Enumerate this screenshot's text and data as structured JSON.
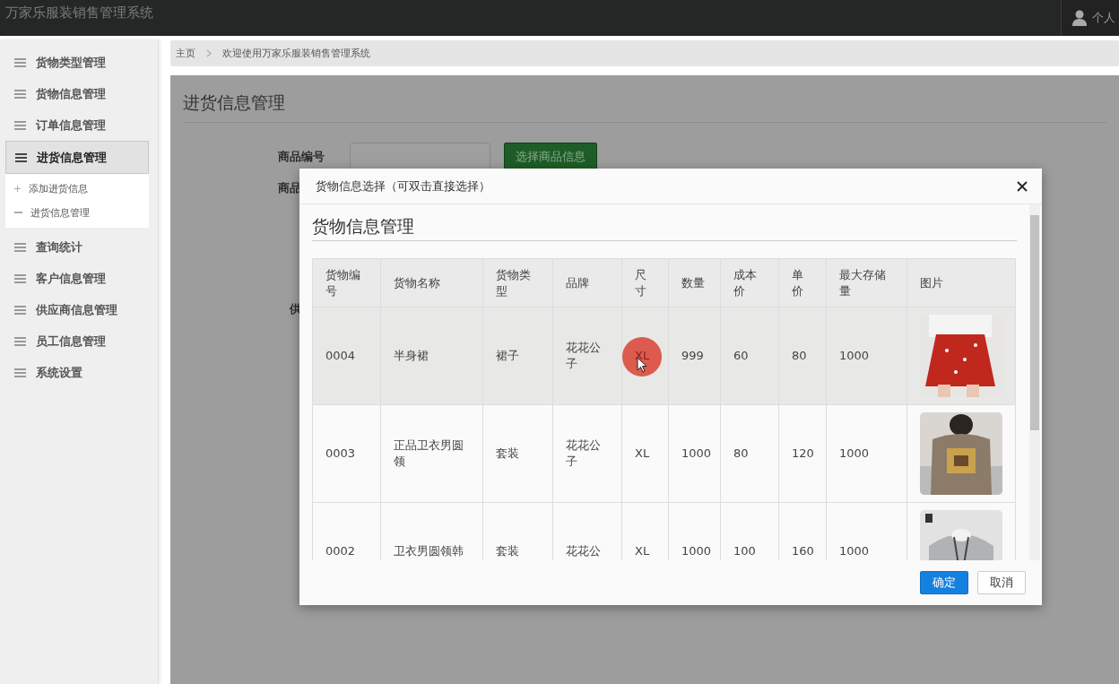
{
  "app": {
    "title": "万家乐服装销售管理系统",
    "user": "个人"
  },
  "sidebar": {
    "items": [
      {
        "label": "货物类型管理",
        "selected": false
      },
      {
        "label": "货物信息管理",
        "selected": false
      },
      {
        "label": "订单信息管理",
        "selected": false
      },
      {
        "label": "进货信息管理",
        "selected": true,
        "expanded": true,
        "children": [
          {
            "label": "添加进货信息",
            "kind": "add"
          },
          {
            "label": "进货信息管理",
            "kind": "list"
          }
        ]
      },
      {
        "label": "查询统计",
        "selected": false
      },
      {
        "label": "客户信息管理",
        "selected": false
      },
      {
        "label": "供应商信息管理",
        "selected": false
      },
      {
        "label": "员工信息管理",
        "selected": false
      },
      {
        "label": "系统设置",
        "selected": false
      }
    ]
  },
  "breadcrumb": [
    "主页",
    "欢迎使用万家乐服装销售管理系统"
  ],
  "page": {
    "title": "进货信息管理",
    "field_label": "商品编号",
    "select_button": "选择商品信息",
    "hidden_labels": [
      "商品",
      "供"
    ]
  },
  "modal": {
    "title": "货物信息选择（可双击直接选择）",
    "heading": "货物信息管理",
    "columns": [
      "货物编号",
      "货物名称",
      "货物类型",
      "品牌",
      "尺寸",
      "数量",
      "成本价",
      "单价",
      "最大存储量",
      "图片"
    ],
    "rows": [
      {
        "selected": true,
        "clicked": true,
        "cells": [
          "0004",
          "半身裙",
          "裙子",
          "花花公子",
          "XL",
          "999",
          "60",
          "80",
          "1000"
        ],
        "image": {
          "kind": "picture"
        }
      },
      {
        "selected": false,
        "clicked": false,
        "cells": [
          "0003",
          "正品卫衣男圆领",
          "套装",
          "花花公子",
          "XL",
          "1000",
          "80",
          "120",
          "1000"
        ],
        "image": {
          "kind": "picture"
        }
      },
      {
        "selected": false,
        "clicked": false,
        "cells": [
          "0002",
          "卫衣男圆领韩",
          "套装",
          "花花公",
          "XL",
          "1000",
          "100",
          "160",
          "1000"
        ],
        "image": {
          "kind": "picture"
        }
      }
    ],
    "buttons": [
      {
        "label": "确定",
        "kind": "primary"
      },
      {
        "label": "取消",
        "kind": "default"
      }
    ]
  }
}
